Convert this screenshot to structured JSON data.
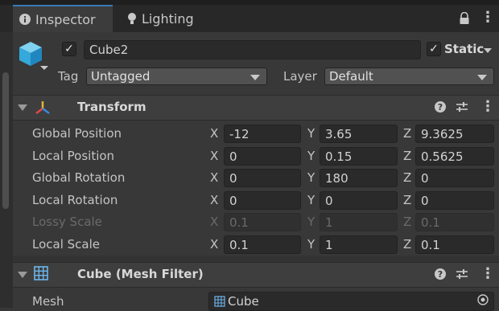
{
  "tabs": [
    {
      "label": "Inspector",
      "icon": "info-icon"
    },
    {
      "label": "Lighting",
      "icon": "lightbulb-icon"
    }
  ],
  "object": {
    "name": "Cube2",
    "active": true,
    "static_label": "Static",
    "static_checked": true,
    "tag_label": "Tag",
    "tag_value": "Untagged",
    "layer_label": "Layer",
    "layer_value": "Default"
  },
  "transform": {
    "title": "Transform",
    "rows": [
      {
        "label": "Global Position",
        "x": "-12",
        "y": "3.65",
        "z": "9.3625",
        "disabled": false
      },
      {
        "label": "Local Position",
        "x": "0",
        "y": "0.15",
        "z": "0.5625",
        "disabled": false
      },
      {
        "label": "Global Rotation",
        "x": "0",
        "y": "180",
        "z": "0",
        "disabled": false
      },
      {
        "label": "Local Rotation",
        "x": "0",
        "y": "0",
        "z": "0",
        "disabled": false
      },
      {
        "label": "Lossy Scale",
        "x": "0.1",
        "y": "1",
        "z": "0.1",
        "disabled": true
      },
      {
        "label": "Local Scale",
        "x": "0.1",
        "y": "1",
        "z": "0.1",
        "disabled": false
      }
    ],
    "axis_x": "X",
    "axis_y": "Y",
    "axis_z": "Z"
  },
  "mesh_filter": {
    "title": "Cube (Mesh Filter)",
    "mesh_label": "Mesh",
    "mesh_value": "Cube"
  },
  "colors": {
    "accent": "#3a79bb",
    "panel": "#383838",
    "field": "#2a2a2a"
  }
}
